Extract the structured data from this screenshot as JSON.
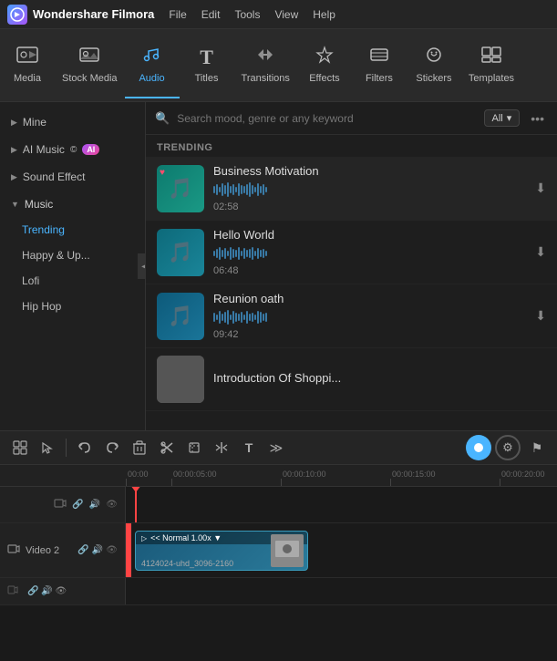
{
  "app": {
    "name": "Wondershare Filmora",
    "logo_icon": "W"
  },
  "menubar": {
    "items": [
      "File",
      "Edit",
      "Tools",
      "View",
      "Help"
    ]
  },
  "toolbar": {
    "buttons": [
      {
        "id": "media",
        "icon": "🎬",
        "label": "Media",
        "active": false
      },
      {
        "id": "stock-media",
        "icon": "📷",
        "label": "Stock Media",
        "active": false
      },
      {
        "id": "audio",
        "icon": "🎵",
        "label": "Audio",
        "active": true
      },
      {
        "id": "titles",
        "icon": "T",
        "label": "Titles",
        "active": false
      },
      {
        "id": "transitions",
        "icon": "↔",
        "label": "Transitions",
        "active": false
      },
      {
        "id": "effects",
        "icon": "✨",
        "label": "Effects",
        "active": false
      },
      {
        "id": "filters",
        "icon": "🎨",
        "label": "Filters",
        "active": false
      },
      {
        "id": "stickers",
        "icon": "⭐",
        "label": "Stickers",
        "active": false
      },
      {
        "id": "templates",
        "icon": "▦",
        "label": "Templates",
        "active": false
      }
    ]
  },
  "sidebar": {
    "sections": [
      {
        "id": "mine",
        "label": "Mine",
        "arrow": "▶",
        "expanded": false
      },
      {
        "id": "ai-music",
        "label": "AI Music",
        "arrow": "▶",
        "has_ai": true,
        "expanded": false
      },
      {
        "id": "sound-effect",
        "label": "Sound Effect",
        "arrow": "▶",
        "expanded": false
      },
      {
        "id": "music",
        "label": "Music",
        "arrow": "▼",
        "expanded": true,
        "children": [
          {
            "id": "trending",
            "label": "Trending",
            "active": true
          },
          {
            "id": "happy-up",
            "label": "Happy & Up...",
            "active": false
          },
          {
            "id": "lofi",
            "label": "Lofi",
            "active": false
          },
          {
            "id": "hip-hop",
            "label": "Hip Hop",
            "active": false
          }
        ]
      }
    ],
    "collapse_icon": "◀"
  },
  "search": {
    "placeholder": "Search mood, genre or any keyword",
    "filter_label": "All",
    "more_icon": "•••"
  },
  "trending": {
    "section_label": "TRENDING",
    "items": [
      {
        "id": "business-motivation",
        "title": "Business Motivation",
        "duration": "02:58",
        "thumb_class": "thumb-bg-1",
        "has_heart": true,
        "waveform": [
          8,
          12,
          6,
          14,
          10,
          16,
          8,
          12,
          6,
          14,
          10,
          8,
          12,
          16,
          10,
          6,
          14,
          8,
          12,
          6
        ]
      },
      {
        "id": "hello-world",
        "title": "Hello World",
        "duration": "06:48",
        "thumb_class": "thumb-bg-2",
        "has_heart": false,
        "waveform": [
          6,
          10,
          14,
          8,
          12,
          6,
          14,
          10,
          8,
          14,
          6,
          12,
          8,
          10,
          14,
          6,
          12,
          8,
          10,
          6
        ]
      },
      {
        "id": "reunion-oath",
        "title": "Reunion oath",
        "duration": "09:42",
        "thumb_class": "thumb-bg-3",
        "has_heart": false,
        "waveform": [
          10,
          6,
          14,
          8,
          12,
          16,
          6,
          14,
          10,
          8,
          12,
          6,
          14,
          8,
          10,
          6,
          14,
          12,
          8,
          10
        ]
      },
      {
        "id": "intro-shopping",
        "title": "Introduction Of Shoppi...",
        "duration": "",
        "thumb_class": "thumb-bg-4",
        "has_heart": false,
        "waveform": []
      }
    ]
  },
  "timeline_toolbar": {
    "buttons": [
      {
        "id": "scene-detect",
        "icon": "⊞",
        "tooltip": "Scene detect"
      },
      {
        "id": "select",
        "icon": "↖",
        "tooltip": "Select"
      },
      {
        "id": "undo",
        "icon": "↩",
        "tooltip": "Undo"
      },
      {
        "id": "redo",
        "icon": "↪",
        "tooltip": "Redo"
      },
      {
        "id": "delete",
        "icon": "🗑",
        "tooltip": "Delete"
      },
      {
        "id": "cut",
        "icon": "✂",
        "tooltip": "Cut"
      },
      {
        "id": "crop",
        "icon": "⊡",
        "tooltip": "Crop"
      },
      {
        "id": "split",
        "icon": "⊢",
        "tooltip": "Split"
      },
      {
        "id": "text",
        "icon": "T",
        "tooltip": "Text"
      },
      {
        "id": "more",
        "icon": "≫",
        "tooltip": "More"
      }
    ],
    "right_buttons": [
      {
        "id": "playhead-circle",
        "icon": "●",
        "is_circle": true
      },
      {
        "id": "settings",
        "icon": "⚙",
        "is_gear": true
      },
      {
        "id": "flag",
        "icon": "⚑",
        "is_flag": true
      }
    ]
  },
  "timeline": {
    "ruler_marks": [
      {
        "time": "00:00"
      },
      {
        "time": "00:00:05:00"
      },
      {
        "time": "00:00:10:00"
      },
      {
        "time": "00:00:15:00"
      },
      {
        "time": "00:00:20:00"
      }
    ],
    "tracks": [
      {
        "id": "video2",
        "icon": "🎬",
        "name": "Video 2",
        "controls": [
          "🔗",
          "🔊",
          "👁"
        ],
        "has_clip": true,
        "clip": {
          "label": "<< Normal 1.00x ▼",
          "text": "4124024-uhd_3096-2160",
          "has_thumbnail": true
        }
      }
    ]
  }
}
